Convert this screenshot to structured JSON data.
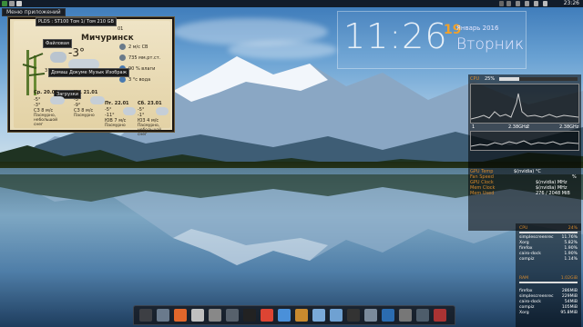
{
  "topbar": {
    "clock": "23:26",
    "apps_menu_label": "Меню приложений"
  },
  "weather": {
    "title_line": "PLDS : ST100 Том 1/ Том 210 GB",
    "city": "Мичуринск",
    "date_partial": "01",
    "current_temp": "-3°",
    "wind": "2 м/с СВ",
    "pressure": "735 мм.рт.ст.",
    "humidity": "90 % влаги",
    "feels": "3 °с вода",
    "tooltip_files": "Файловая",
    "tooltip_docs": "Домаш Докуме Музык Изображ",
    "tooltip_downloads": "Загрузки",
    "small_value": "3",
    "days": [
      {
        "name": "Ср. 20.01",
        "hi": "-5°",
        "lo": "-3°",
        "note": "Пасмурно, небольшой снег",
        "wind": "СЗ 8 м/с"
      },
      {
        "name": "Чт. 21.01",
        "hi": "-5°",
        "lo": "-9°",
        "note": "Пасмурно",
        "wind": "СЗ 8 м/с"
      },
      {
        "name": "Пт. 22.01",
        "hi": "-5°",
        "lo": "-11°",
        "note": "Пасмурно",
        "wind": "ЮВ 7 м/с"
      },
      {
        "name": "Сб. 23.01",
        "hi": "-5°",
        "lo": "-1°",
        "note": "Пасмурно, небольшой снег",
        "wind": "Ю3 4 м/с"
      }
    ]
  },
  "clock": {
    "time": "11:26",
    "day_number": "19",
    "month_year": "Январь 2016",
    "weekday": "Вторник"
  },
  "sysmon": {
    "cpu_label": "CPU",
    "cpu_percent": "25%",
    "cpu_percent_value": 25,
    "core1_label": "1",
    "core1_freq": "2.38GHz",
    "core2_label": "2",
    "core2_freq": "2.38GHz",
    "gpu_rows": [
      {
        "label": "GPU Temp",
        "value": "$(nvidia) °C"
      },
      {
        "label": "Fan Speed",
        "value": "%"
      },
      {
        "label": "GPU Clock",
        "value": "$(nvidia) MHz"
      },
      {
        "label": "Mem Clock",
        "value": "$(nvidia) MHz"
      },
      {
        "label": "Mem Used",
        "value": "276 / 2048 MiB"
      }
    ]
  },
  "procs": {
    "cpu_header": "CPU",
    "cpu_total": "24%",
    "cpu_rows": [
      {
        "name": "simplescreenrec",
        "value": "11.76%"
      },
      {
        "name": "Xorg",
        "value": "5.82%"
      },
      {
        "name": "firefox",
        "value": "1.90%"
      },
      {
        "name": "cairo-dock",
        "value": "1.90%"
      },
      {
        "name": "compiz",
        "value": "1.14%"
      }
    ],
    "ram_header": "RAM",
    "ram_total": "1.02GiB",
    "ram_rows": [
      {
        "name": "firefox",
        "value": "286MiB"
      },
      {
        "name": "simplescreenrec",
        "value": "229MiB"
      },
      {
        "name": "cairo-dock",
        "value": "54MiB"
      },
      {
        "name": "compiz",
        "value": "105MiB"
      },
      {
        "name": "Xorg",
        "value": "95.8MiB"
      }
    ]
  },
  "dock": {
    "icons": [
      "files-icon",
      "browser-icon",
      "firefox-icon",
      "media-icon",
      "torrent-icon",
      "settings-icon",
      "terminal-icon",
      "palette-icon",
      "chat-icon",
      "folder-icon",
      "folder-home-icon",
      "image-viewer-icon",
      "video-icon",
      "photo-icon",
      "monitor-icon",
      "trash-icon",
      "app-icon",
      "power-icon"
    ],
    "colors": [
      "#3d3f44",
      "#6a7a8c",
      "#e2672b",
      "#c0c0c0",
      "#888",
      "#57616c",
      "#222",
      "#d43",
      "#4a90d9",
      "#c98a2e",
      "#7aa9d8",
      "#6fa1d2",
      "#333",
      "#7b8b9c",
      "#2b6cb0",
      "#777",
      "#4e5d6b",
      "#a33"
    ]
  }
}
